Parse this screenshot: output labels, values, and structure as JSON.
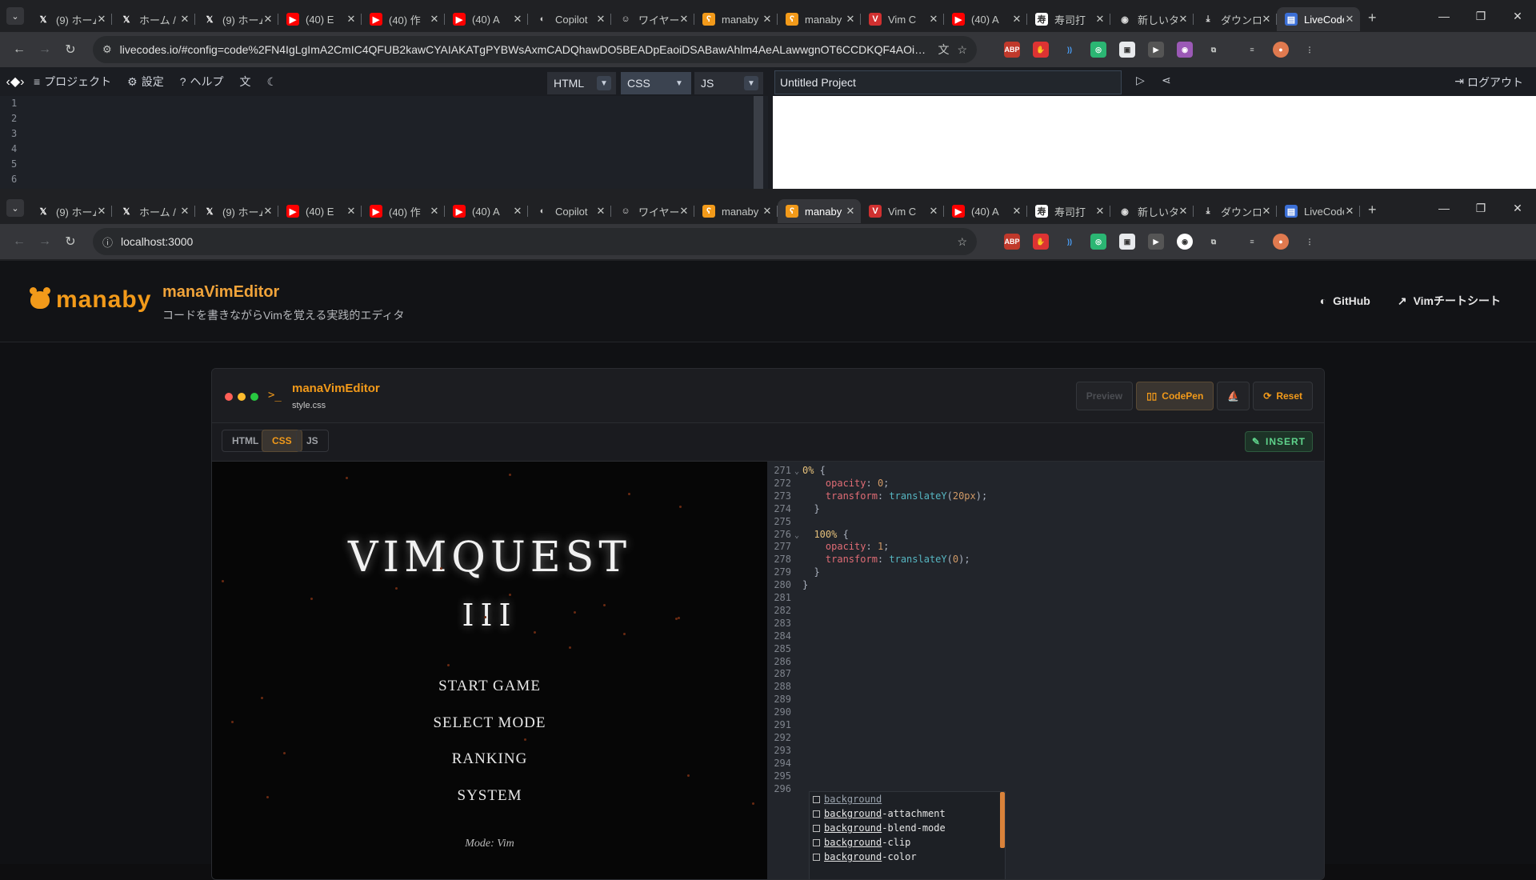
{
  "browser_top": {
    "tabs": [
      {
        "title": "(9) ホーム",
        "icon": "x-logo-icon"
      },
      {
        "title": "ホーム / X",
        "icon": "x-logo-icon"
      },
      {
        "title": "(9) ホーム",
        "icon": "x-logo-icon"
      },
      {
        "title": "(40) E",
        "icon": "youtube-icon"
      },
      {
        "title": "(40) 作",
        "icon": "youtube-icon"
      },
      {
        "title": "(40) A",
        "icon": "youtube-icon"
      },
      {
        "title": "Copilot",
        "icon": "github-icon"
      },
      {
        "title": "ワイヤー",
        "icon": "copilot-icon"
      },
      {
        "title": "manaby",
        "icon": "bear-icon"
      },
      {
        "title": "manaby",
        "icon": "bear-icon"
      },
      {
        "title": "Vim C",
        "icon": "vim-icon"
      },
      {
        "title": "(40) A",
        "icon": "youtube-icon"
      },
      {
        "title": "寿司打",
        "icon": "sushi-icon"
      },
      {
        "title": "新しいタブ",
        "icon": "chrome-icon"
      },
      {
        "title": "ダウンロード",
        "icon": "download-icon"
      },
      {
        "title": "LiveCodes",
        "icon": "livecodes-icon"
      }
    ],
    "active_tab": 15,
    "url": "livecodes.io/#config=code%2FN4IgLgImA2CmIC4QFUB2kawCYAIAKATgPYBWsAxmCADQhawDO5BEADpEaoiDSABawAhlm4AeALawwgnOT6CCDKQF4AOigAqAMQC0ADnU4A9AD5VqCVJmpBktSABuEWA..."
  },
  "livecodes": {
    "menu": [
      {
        "label": "プロジェクト",
        "icon": "menu-icon"
      },
      {
        "label": "設定",
        "icon": "settings-icon"
      },
      {
        "label": "ヘルプ",
        "icon": "help-icon"
      }
    ],
    "langs": [
      "HTML",
      "CSS",
      "JS"
    ],
    "selected_lang": "CSS",
    "project_title": "Untitled Project",
    "logout": "ログアウト",
    "line_numbers": [
      "1",
      "2",
      "3",
      "4",
      "5",
      "6"
    ]
  },
  "browser_bottom": {
    "tabs": [
      {
        "title": "(9) ホーム",
        "icon": "x-logo-icon"
      },
      {
        "title": "ホーム / X",
        "icon": "x-logo-icon"
      },
      {
        "title": "(9) ホーム",
        "icon": "x-logo-icon"
      },
      {
        "title": "(40) E",
        "icon": "youtube-icon"
      },
      {
        "title": "(40) 作",
        "icon": "youtube-icon"
      },
      {
        "title": "(40) A",
        "icon": "youtube-icon"
      },
      {
        "title": "Copilot",
        "icon": "github-icon"
      },
      {
        "title": "ワイヤー",
        "icon": "copilot-icon"
      },
      {
        "title": "manaby",
        "icon": "bear-icon"
      },
      {
        "title": "manaby",
        "icon": "bear-icon"
      },
      {
        "title": "Vim C",
        "icon": "vim-icon"
      },
      {
        "title": "(40) A",
        "icon": "youtube-icon"
      },
      {
        "title": "寿司打",
        "icon": "sushi-icon"
      },
      {
        "title": "新しいタブ",
        "icon": "chrome-icon"
      },
      {
        "title": "ダウンロード",
        "icon": "download-icon"
      },
      {
        "title": "LiveCodes",
        "icon": "livecodes-icon"
      }
    ],
    "active_tab": 9,
    "url": "localhost:3000"
  },
  "app": {
    "brand": "manaby",
    "title": "manaVimEditor",
    "subtitle": "コードを書きながらVimを覚える実践的エディタ",
    "links": [
      {
        "label": "GitHub",
        "icon": "github-icon"
      },
      {
        "label": "Vimチートシート",
        "icon": "external-link-icon"
      }
    ],
    "editor": {
      "title": "manaVimEditor",
      "file": "style.css",
      "buttons": {
        "preview": "Preview",
        "codepen": "CodePen",
        "reset": "Reset"
      },
      "tabs": [
        "HTML",
        "CSS",
        "JS"
      ],
      "active_tab": "CSS",
      "mode": "INSERT"
    },
    "game": {
      "title": "VIMQUEST",
      "subtitle": "III",
      "menu": [
        "START GAME",
        "SELECT MODE",
        "RANKING",
        "SYSTEM"
      ],
      "mode_text": "Mode: Vim"
    },
    "code_lines": [
      {
        "n": "271",
        "fold": true,
        "parts": [
          [
            "k",
            "0%"
          ],
          [
            "w",
            " {"
          ]
        ]
      },
      {
        "n": "272",
        "parts": [
          [
            "p",
            "    opacity"
          ],
          [
            "w",
            ": "
          ],
          [
            "n",
            "0"
          ],
          [
            "w",
            ";"
          ]
        ]
      },
      {
        "n": "273",
        "parts": [
          [
            "p",
            "    transform"
          ],
          [
            "w",
            ": "
          ],
          [
            "f",
            "translateY"
          ],
          [
            "w",
            "("
          ],
          [
            "n",
            "20px"
          ],
          [
            "w",
            ");"
          ]
        ]
      },
      {
        "n": "274",
        "parts": [
          [
            "w",
            "  }"
          ]
        ]
      },
      {
        "n": "275",
        "parts": []
      },
      {
        "n": "276",
        "fold": true,
        "parts": [
          [
            "k",
            "  100%"
          ],
          [
            "w",
            " {"
          ]
        ]
      },
      {
        "n": "277",
        "parts": [
          [
            "p",
            "    opacity"
          ],
          [
            "w",
            ": "
          ],
          [
            "n",
            "1"
          ],
          [
            "w",
            ";"
          ]
        ]
      },
      {
        "n": "278",
        "parts": [
          [
            "p",
            "    transform"
          ],
          [
            "w",
            ": "
          ],
          [
            "f",
            "translateY"
          ],
          [
            "w",
            "("
          ],
          [
            "n",
            "0"
          ],
          [
            "w",
            ");"
          ]
        ]
      },
      {
        "n": "279",
        "parts": [
          [
            "w",
            "  }"
          ]
        ]
      },
      {
        "n": "280",
        "parts": [
          [
            "w",
            "}"
          ]
        ]
      },
      {
        "n": "281",
        "parts": []
      },
      {
        "n": "282",
        "parts": []
      },
      {
        "n": "283",
        "parts": []
      },
      {
        "n": "284",
        "parts": []
      },
      {
        "n": "285",
        "parts": []
      },
      {
        "n": "286",
        "parts": []
      },
      {
        "n": "287",
        "parts": []
      },
      {
        "n": "288",
        "parts": []
      },
      {
        "n": "289",
        "parts": []
      },
      {
        "n": "290",
        "parts": []
      },
      {
        "n": "291",
        "parts": []
      },
      {
        "n": "292",
        "parts": []
      },
      {
        "n": "293",
        "parts": []
      },
      {
        "n": "294",
        "parts": []
      },
      {
        "n": "295",
        "parts": []
      },
      {
        "n": "296",
        "parts": []
      }
    ],
    "autocomplete": [
      {
        "match": "background",
        "rest": ""
      },
      {
        "match": "background",
        "rest": "-attachment"
      },
      {
        "match": "background",
        "rest": "-blend-mode"
      },
      {
        "match": "background",
        "rest": "-clip"
      },
      {
        "match": "background",
        "rest": "-color"
      }
    ]
  },
  "colors": {
    "accent": "#f29a1a",
    "insert": "#5fd38b",
    "dot_red": "#ff5f57",
    "dot_yellow": "#febc2e",
    "dot_green": "#28c840"
  }
}
